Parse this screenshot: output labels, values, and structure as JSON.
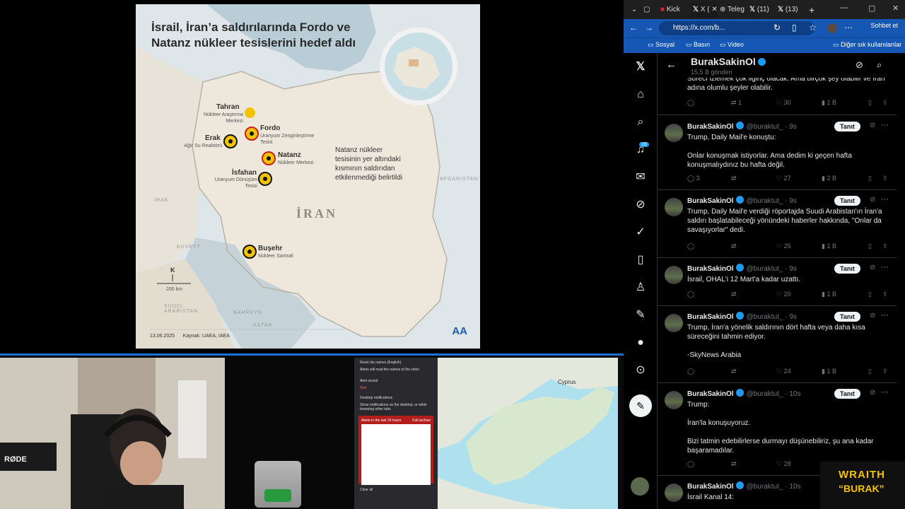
{
  "map": {
    "title": "İsrail, İran’a saldırılarında Fordo ve Natanz nükleer tesislerini hedef aldı",
    "country": "İRAN",
    "note": "Natanz nükleer tesisinin yer altındaki kısmının saldırıdan etkilenmediği belirtildi",
    "sites": [
      {
        "name": "Tahran",
        "sub": "Nükleer Araştırma Merkezi"
      },
      {
        "name": "Fordo",
        "sub": "Uranyum Zenginleştirme Tesisi"
      },
      {
        "name": "Erak",
        "sub": "Ağır Su Reaktörü"
      },
      {
        "name": "Natanz",
        "sub": "Nükleer Merkezi"
      },
      {
        "name": "İsfahan",
        "sub": "Uranyum Dönüşüm Tesisi"
      },
      {
        "name": "Buşehr",
        "sub": "Nükleer Santrali"
      }
    ],
    "regions": {
      "irak": "IRAK",
      "kuveyt": "KUVEYT",
      "suudi": "SUUDİ ARABİSTAN",
      "bahreyn": "BAHREYN",
      "katar": "KATAR",
      "afganistan": "AFGANİSTAN"
    },
    "compass": "K",
    "scale": "200 km",
    "date": "13.06.2025",
    "source": "Kaynak: UAEA, IAEA",
    "logo": "AA"
  },
  "alerts_panel": {
    "read_city": "Read city names (English)",
    "read_city_sub": "Alerts will read the names of the cities",
    "alert_sound": "Alert sound",
    "desktop": "Desktop notifications",
    "desktop_sub": "Show notifications on the desktop, or while browsing other tabs",
    "last24": "Alerts in the last 24 hours",
    "full_archive": "Full archive",
    "clear_all": "Clear all",
    "test": "Test"
  },
  "cyprus_map": {
    "label": "Cyprus"
  },
  "browser": {
    "tabs": [
      {
        "label": "Kick"
      },
      {
        "label": "X ("
      },
      {
        "label": "Teleg"
      },
      {
        "label": "(11)"
      },
      {
        "label": "(13)"
      }
    ],
    "url": "https://x.com/b...",
    "chat": "Sohbet et",
    "favorites": [
      "Sosyal",
      "Basın",
      "Video"
    ],
    "other_favorites": "Diğer sık kullanılanlar"
  },
  "profile": {
    "name": "BurakSakinOl",
    "posts": "15,5 B gönderi"
  },
  "nav": {
    "notifications_badge": "16"
  },
  "partial_tweet": {
    "text": "Sürecİ izlemek çok ilginç olacak. Ama birçok şey olabilir ve İran adına olumlu şeyler olabilir.",
    "replies": "",
    "reposts": "1",
    "likes": "30",
    "views": "1 B"
  },
  "tweets": [
    {
      "name": "BurakSakinOl",
      "handle": "@buraktut_ · 9s",
      "follow": "Tanıt",
      "paragraphs": [
        "Trump, Daily Mail'e konuştu:",
        "Onlar konuşmak istiyorlar. Ama dedim ki geçen hafta konuşmalıydınız bu hafta değil."
      ],
      "replies": "3",
      "reposts": "",
      "likes": "27",
      "views": "2 B"
    },
    {
      "name": "BurakSakinOl",
      "handle": "@buraktut_ · 9s",
      "follow": "Tanıt",
      "paragraphs": [
        "Trump, Daily Mail'e verdiği röportajda Suudi Arabistan'ın İran'a saldırı başlatabileceği yönündeki haberler hakkında, \"Onlar da savaşıyorlar\" dedi."
      ],
      "replies": "",
      "reposts": "",
      "likes": "25",
      "views": "1 B"
    },
    {
      "name": "BurakSakinOl",
      "handle": "@buraktut_ · 9s",
      "follow": "Tanıt",
      "paragraphs": [
        "İsrail, OHAL'i 12 Mart'a kadar uzattı."
      ],
      "replies": "",
      "reposts": "",
      "likes": "20",
      "views": "1 B"
    },
    {
      "name": "BurakSakinOl",
      "handle": "@buraktut_ · 9s",
      "follow": "Tanıt",
      "paragraphs": [
        "Trump, İran'a yönelik saldırının dört hafta veya daha kısa süreceğini tahmin ediyor.",
        "-SkyNews Arabia"
      ],
      "replies": "",
      "reposts": "",
      "likes": "24",
      "views": "1 B"
    },
    {
      "name": "BurakSakinOl",
      "handle": "@buraktut_ · 10s",
      "follow": "Tanıt",
      "paragraphs": [
        "Trump:",
        "İran'la konuşuyoruz.",
        "Bizi tatmin edebilirlerse durmayı düşünebiliriz, şu ana kadar başaramadılar."
      ],
      "replies": "",
      "reposts": "",
      "likes": "28",
      "views": ""
    },
    {
      "name": "BurakSakinOl",
      "handle": "@buraktut_ · 10s",
      "follow": "",
      "paragraphs": [
        "İsrail Kanal 14:"
      ],
      "replies": "",
      "reposts": "",
      "likes": "",
      "views": ""
    }
  ],
  "overlay": {
    "line1": "WRAITH",
    "line2": "“BURAK”"
  },
  "webcam": {
    "mic_brand": "RØDE"
  },
  "colors": {
    "x_blue": "#1d9bf0",
    "edge_blue": "#1557b3",
    "nuke_yellow": "#f0c400"
  }
}
